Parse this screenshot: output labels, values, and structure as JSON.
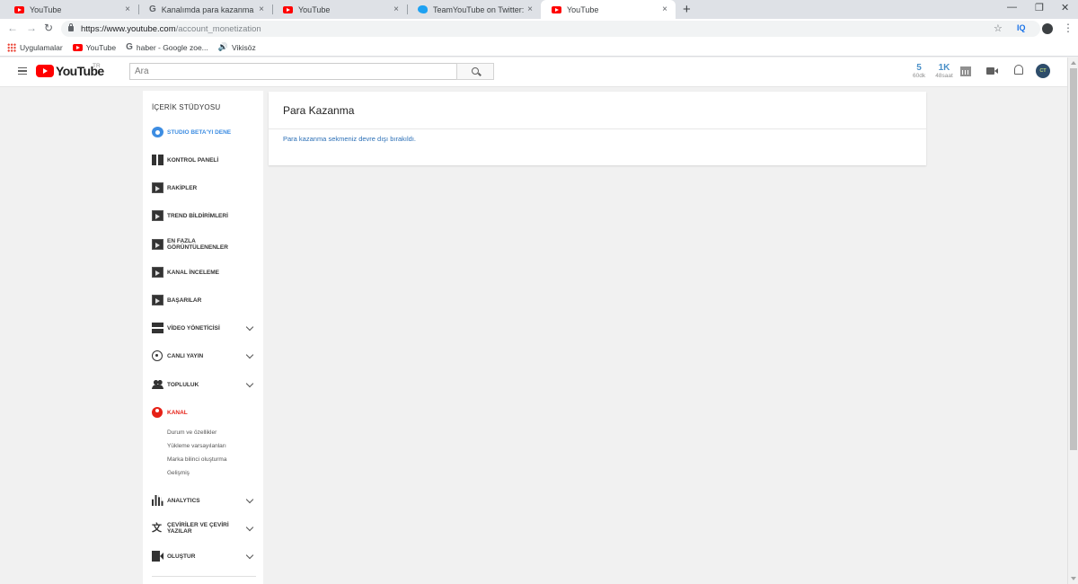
{
  "browser": {
    "tabs": [
      {
        "title": "YouTube",
        "favicon": "youtube-icon"
      },
      {
        "title": "Kanalımda para kazanma özelliğ",
        "favicon": "google-icon"
      },
      {
        "title": "YouTube",
        "favicon": "youtube-icon"
      },
      {
        "title": "TeamYouTube on Twitter: \"Hi the",
        "favicon": "twitter-icon"
      },
      {
        "title": "YouTube",
        "favicon": "youtube-icon",
        "active": true
      }
    ],
    "new_tab": "+",
    "close_glyph": "×",
    "url_host": "https://www.youtube.com",
    "url_path": "/account_monetization",
    "extension_label": "IQ",
    "bookmarks": [
      {
        "label": "Uygulamalar",
        "icon": "apps-icon"
      },
      {
        "label": "YouTube",
        "icon": "youtube-icon"
      },
      {
        "label": "haber - Google zoe...",
        "icon": "google-icon"
      },
      {
        "label": "Vikisöz",
        "icon": "speaker-icon"
      }
    ]
  },
  "masthead": {
    "logo_text": "YouTube",
    "region": "TR",
    "search_placeholder": "Ara",
    "stats": [
      {
        "value": "5",
        "sub": "60dk"
      },
      {
        "value": "1K",
        "sub": "48saat"
      }
    ],
    "avatar_initials": "CT"
  },
  "sidebar": {
    "title": "İÇERİK STÜDYOSU",
    "items": [
      {
        "label": "STUDIO BETA'YI DENE",
        "icon": "gear-icon",
        "state": "blue"
      },
      {
        "label": "KONTROL PANELİ",
        "icon": "dashboard-icon"
      },
      {
        "label": "RAKİPLER",
        "icon": "play-icon"
      },
      {
        "label": "TREND BİLDİRİMLERİ",
        "icon": "play-icon"
      },
      {
        "label": "EN FAZLA GÖRÜNTÜLENENLER",
        "icon": "play-icon"
      },
      {
        "label": "KANAL İNCELEME",
        "icon": "play-icon"
      },
      {
        "label": "BAŞARILAR",
        "icon": "play-icon"
      },
      {
        "label": "VİDEO YÖNETİCİSİ",
        "icon": "video-manager-icon",
        "expandable": true
      },
      {
        "label": "CANLI YAYIN",
        "icon": "live-icon",
        "expandable": true
      },
      {
        "label": "TOPLULUK",
        "icon": "community-icon",
        "expandable": true
      },
      {
        "label": "KANAL",
        "icon": "channel-icon",
        "state": "red"
      },
      {
        "label": "ANALYTICS",
        "icon": "analytics-icon",
        "expandable": true
      },
      {
        "label": "ÇEVİRİLER VE ÇEVİRİ YAZILAR",
        "icon": "translate-icon",
        "expandable": true
      },
      {
        "label": "OLUŞTUR",
        "icon": "create-icon",
        "expandable": true
      }
    ],
    "kanal_subitems": [
      "Durum ve özellikler",
      "Yükleme varsayılanları",
      "Marka bilinci oluşturma",
      "Gelişmiş"
    ]
  },
  "main": {
    "title": "Para Kazanma",
    "message": "Para kazanma sekmeniz devre dışı bırakıldı."
  },
  "colors": {
    "accent_blue": "#3d8de2",
    "accent_red": "#e62117",
    "link_blue": "#2b6fb6"
  }
}
